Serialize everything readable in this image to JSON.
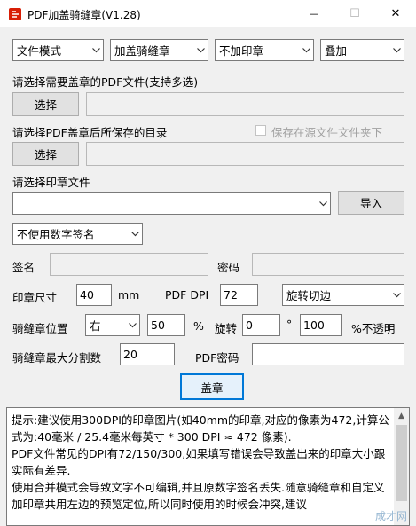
{
  "window": {
    "title": "PDF加盖骑缝章(V1.28)",
    "minimize_glyph": "—",
    "maximize_glyph": "☐",
    "close_glyph": "✕"
  },
  "toolbar": {
    "mode": "文件模式",
    "stamp_type": "加盖骑缝章",
    "stamp_option": "不加印章",
    "overlay": "叠加"
  },
  "pdf_select": {
    "label": "请选择需要盖章的PDF文件(支持多选)",
    "button": "选择",
    "path": ""
  },
  "output_dir": {
    "label": "请选择PDF盖章后所保存的目录",
    "checkbox_label": "保存在源文件文件夹下",
    "button": "选择",
    "path": ""
  },
  "stamp_file": {
    "label": "请选择印章文件",
    "value": "",
    "import_button": "导入"
  },
  "digital_signature": {
    "select": "不使用数字签名",
    "signer_label": "签名",
    "signer_value": "",
    "password_label": "密码",
    "password_value": ""
  },
  "stamp_size": {
    "label": "印章尺寸",
    "value": "40",
    "unit": "mm",
    "dpi_label": "PDF DPI",
    "dpi_value": "72",
    "rotate_mode": "旋转切边"
  },
  "seam_position": {
    "label": "骑缝章位置",
    "side": "右",
    "percent": "50",
    "percent_sign": "%",
    "rotate_label": "旋转",
    "rotate_value": "0",
    "degree_sign": "°",
    "opacity_value": "100",
    "opacity_label": "%不透明"
  },
  "split": {
    "label": "骑缝章最大分割数",
    "value": "20",
    "pdf_password_label": "PDF密码",
    "pdf_password_value": ""
  },
  "stamp_button": "盖章",
  "tips": {
    "line1": "提示:建议使用300DPI的印章图片(如40mm的印章,对应的像素为472,计算公式为:40毫米 / 25.4毫米每英寸 * 300 DPI ≈ 472 像素).",
    "line2": "PDF文件常见的DPI有72/150/300,如果填写错误会导致盖出来的印章大小跟实际有差异.",
    "line3": "使用合并模式会导致文字不可编辑,并且原数字签名丢失.随意骑缝章和自定义加印章共用左边的预览定位,所以同时使用的时候会冲突,建议",
    "watermark": "成才网"
  },
  "colors": {
    "accent": "#0078d7",
    "app_icon": "#d81e06"
  }
}
